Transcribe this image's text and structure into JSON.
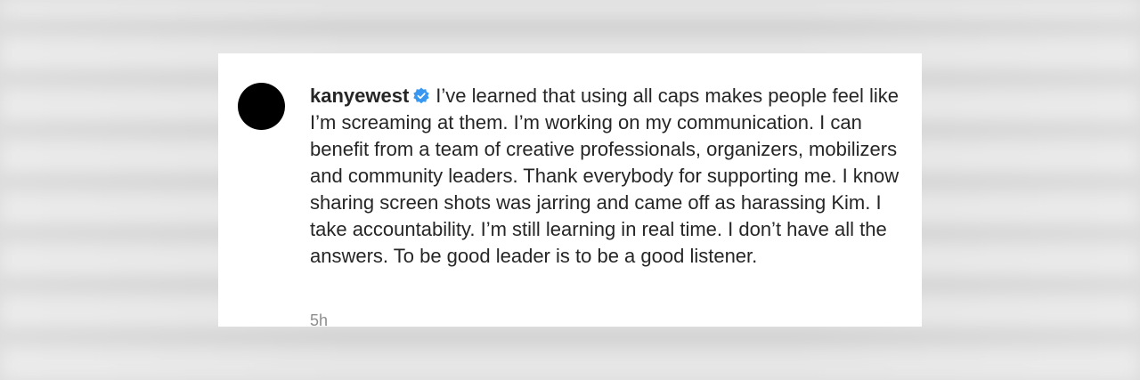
{
  "comment": {
    "username": "kanyewest",
    "verified_icon": "verified-badge-icon",
    "verified_color": "#3897f0",
    "text": "I’ve learned that using all caps makes people feel like I’m screaming at them. I’m working on my communication. I can benefit from a team of creative professionals, organizers, mobilizers and community leaders. Thank everybody for supporting me. I know sharing screen shots was jarring and came off as harassing Kim. I take accountability. I’m still learning in real time. I don’t have all the answers. To be good leader is to be a good listener.",
    "timestamp": "5h"
  }
}
